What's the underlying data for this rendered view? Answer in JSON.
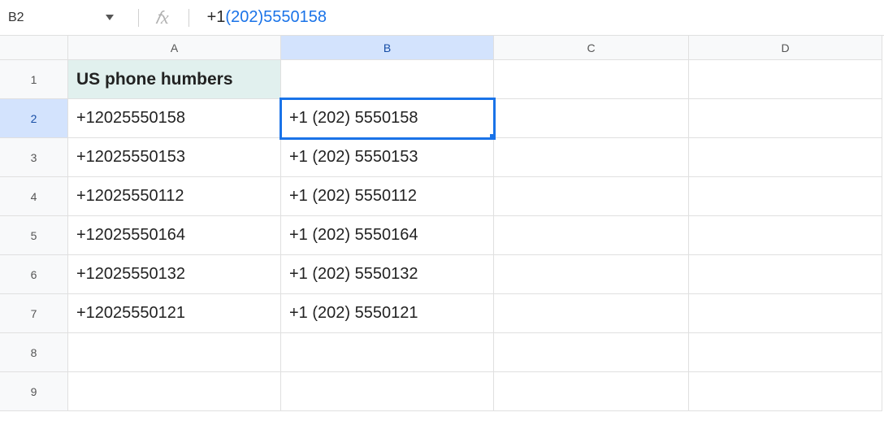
{
  "name_box": "B2",
  "formula": {
    "parts": [
      {
        "text": "+1 ",
        "cls": "t-dark"
      },
      {
        "text": "(",
        "cls": "t-link"
      },
      {
        "text": "202",
        "cls": "t-link"
      },
      {
        "text": ")",
        "cls": "t-link"
      },
      {
        "text": " ",
        "cls": "t-dark"
      },
      {
        "text": "5550158",
        "cls": "t-link"
      }
    ]
  },
  "columns": [
    "A",
    "B",
    "C",
    "D"
  ],
  "col_widths": {
    "A": "cA",
    "B": "cB",
    "C": "cC",
    "D": "cD"
  },
  "rows": [
    1,
    2,
    3,
    4,
    5,
    6,
    7,
    8,
    9
  ],
  "header_cell": {
    "row": 1,
    "col": "A",
    "text": "US phone humbers"
  },
  "active_cell": {
    "row": 2,
    "col": "B"
  },
  "cells": {
    "A": {
      "2": "+12025550158",
      "3": "+12025550153",
      "4": "+12025550112",
      "5": "+12025550164",
      "6": "+12025550132",
      "7": "+12025550121"
    },
    "B": {
      "2": "+1 (202) 5550158",
      "3": "+1 (202) 5550153",
      "4": "+1 (202) 5550112",
      "5": "+1 (202) 5550164",
      "6": "+1 (202) 5550132",
      "7": "+1 (202) 5550121"
    }
  },
  "fx_label": "fx"
}
